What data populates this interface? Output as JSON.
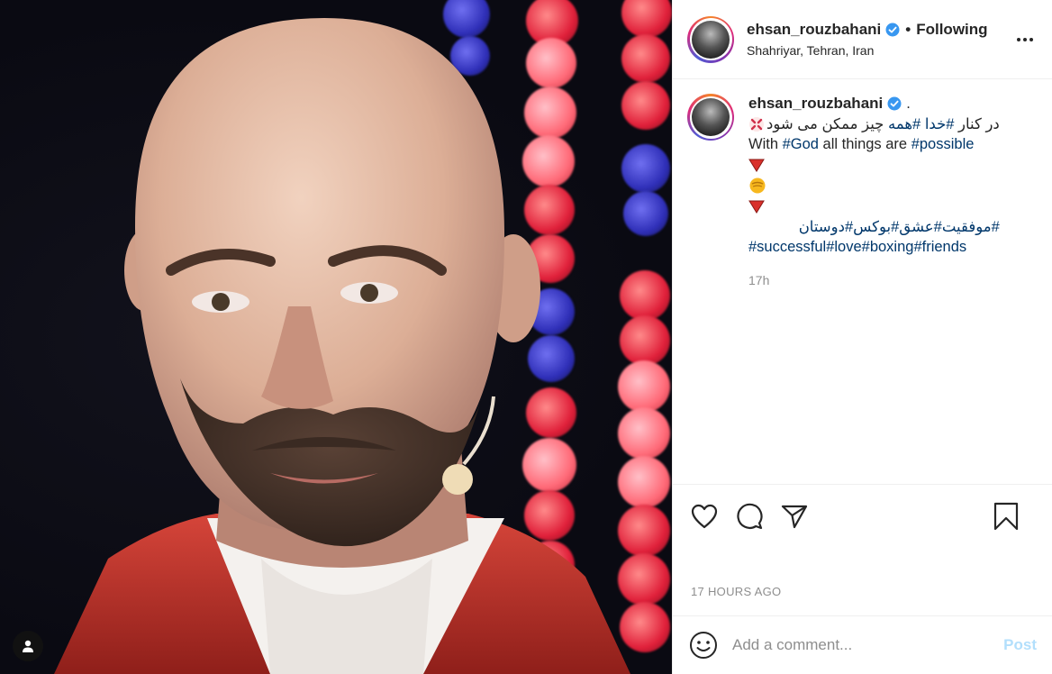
{
  "post": {
    "username": "ehsan_rouzbahani",
    "verified": true,
    "follow_separator": "•",
    "follow_status": "Following",
    "location": "Shahriyar, Tehran, Iran",
    "more_icon": "more-options-icon"
  },
  "caption": {
    "username": "ehsan_rouzbahani",
    "suffix": ".",
    "line1_pre": "در کنار ",
    "line1_tag1": "#خدا",
    "line1_mid": " ",
    "line1_tag2": "#همه",
    "line1_post": " چیز ممکن می شود",
    "line2_pre": "With ",
    "line2_tag1": "#God",
    "line2_mid": " all things are ",
    "line2_tag2": "#possible",
    "emoji_1": "down-red-triangle",
    "emoji_2": "fist-emoji",
    "emoji_3": "down-red-triangle",
    "tags_fa": "#موفقیت#عشق#بوکس#دوستان",
    "tags_en": "#successful#love#boxing#friends",
    "relative_time": "17h"
  },
  "actions": {
    "like_icon": "heart-icon",
    "comment_icon": "comment-icon",
    "share_icon": "share-icon",
    "save_icon": "bookmark-icon"
  },
  "timestamp": "17 HOURS AGO",
  "comment": {
    "placeholder": "Add a comment...",
    "post_label": "Post",
    "emoji_icon": "smiley-icon"
  },
  "colors": {
    "link": "#00376b",
    "verified": "#3897f0",
    "post_disabled": "#b2dffc",
    "muted": "#8e8e8e"
  }
}
